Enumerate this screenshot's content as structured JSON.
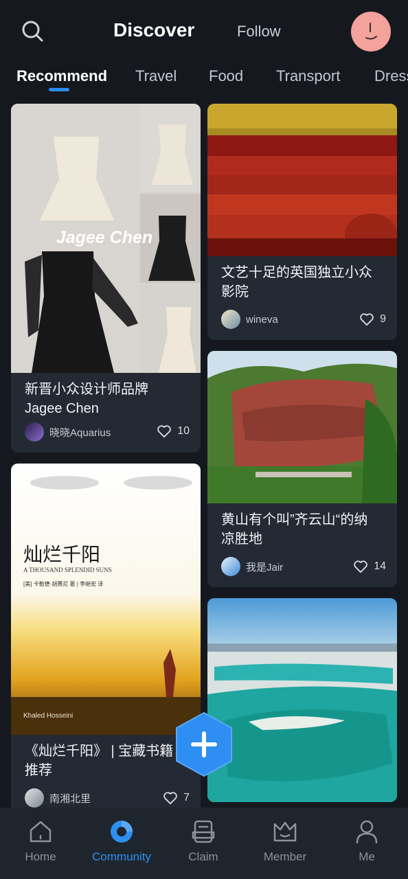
{
  "header": {
    "discover_label": "Discover",
    "follow_label": "Follow"
  },
  "tabs": [
    {
      "label": "Recommend",
      "active": true
    },
    {
      "label": "Travel",
      "active": false
    },
    {
      "label": "Food",
      "active": false
    },
    {
      "label": "Transport",
      "active": false
    },
    {
      "label": "Dress",
      "active": false
    }
  ],
  "posts": [
    {
      "image_text": "Jagee Chen",
      "title_line1": "新晋小众设计师品牌",
      "title_line2": "Jagee Chen",
      "author": "晓晓Aquarius",
      "likes": "10"
    },
    {
      "title_line1": "文艺十足的英国独立小众",
      "title_line2": "影院",
      "author": "wineva",
      "likes": "9"
    },
    {
      "cover_title": "灿烂千阳",
      "cover_subtitle": "A THOUSAND SPLENDID SUNS",
      "cover_credits": "[美] 卡勒德·胡赛尼 著 | 李继宏 译",
      "cover_author": "Khaled Hosseini",
      "title_line1": "《灿烂千阳》 | 宝藏书籍",
      "title_line2": "推荐",
      "author": "南湘北里",
      "likes": "7"
    },
    {
      "title_line1": "黄山有个叫”齐云山“的纳",
      "title_line2": "凉胜地",
      "author": "我是Jair",
      "likes": "14"
    }
  ],
  "bottom_nav": [
    {
      "label": "Home",
      "icon": "home-icon",
      "active": false
    },
    {
      "label": "Community",
      "icon": "community-icon",
      "active": true
    },
    {
      "label": "Claim",
      "icon": "claim-icon",
      "active": false
    },
    {
      "label": "Member",
      "icon": "member-crown-icon",
      "active": false
    },
    {
      "label": "Me",
      "icon": "person-icon",
      "active": false
    }
  ],
  "colors": {
    "accent": "#2b8cf0",
    "background": "#15191f",
    "card": "#232a33"
  }
}
